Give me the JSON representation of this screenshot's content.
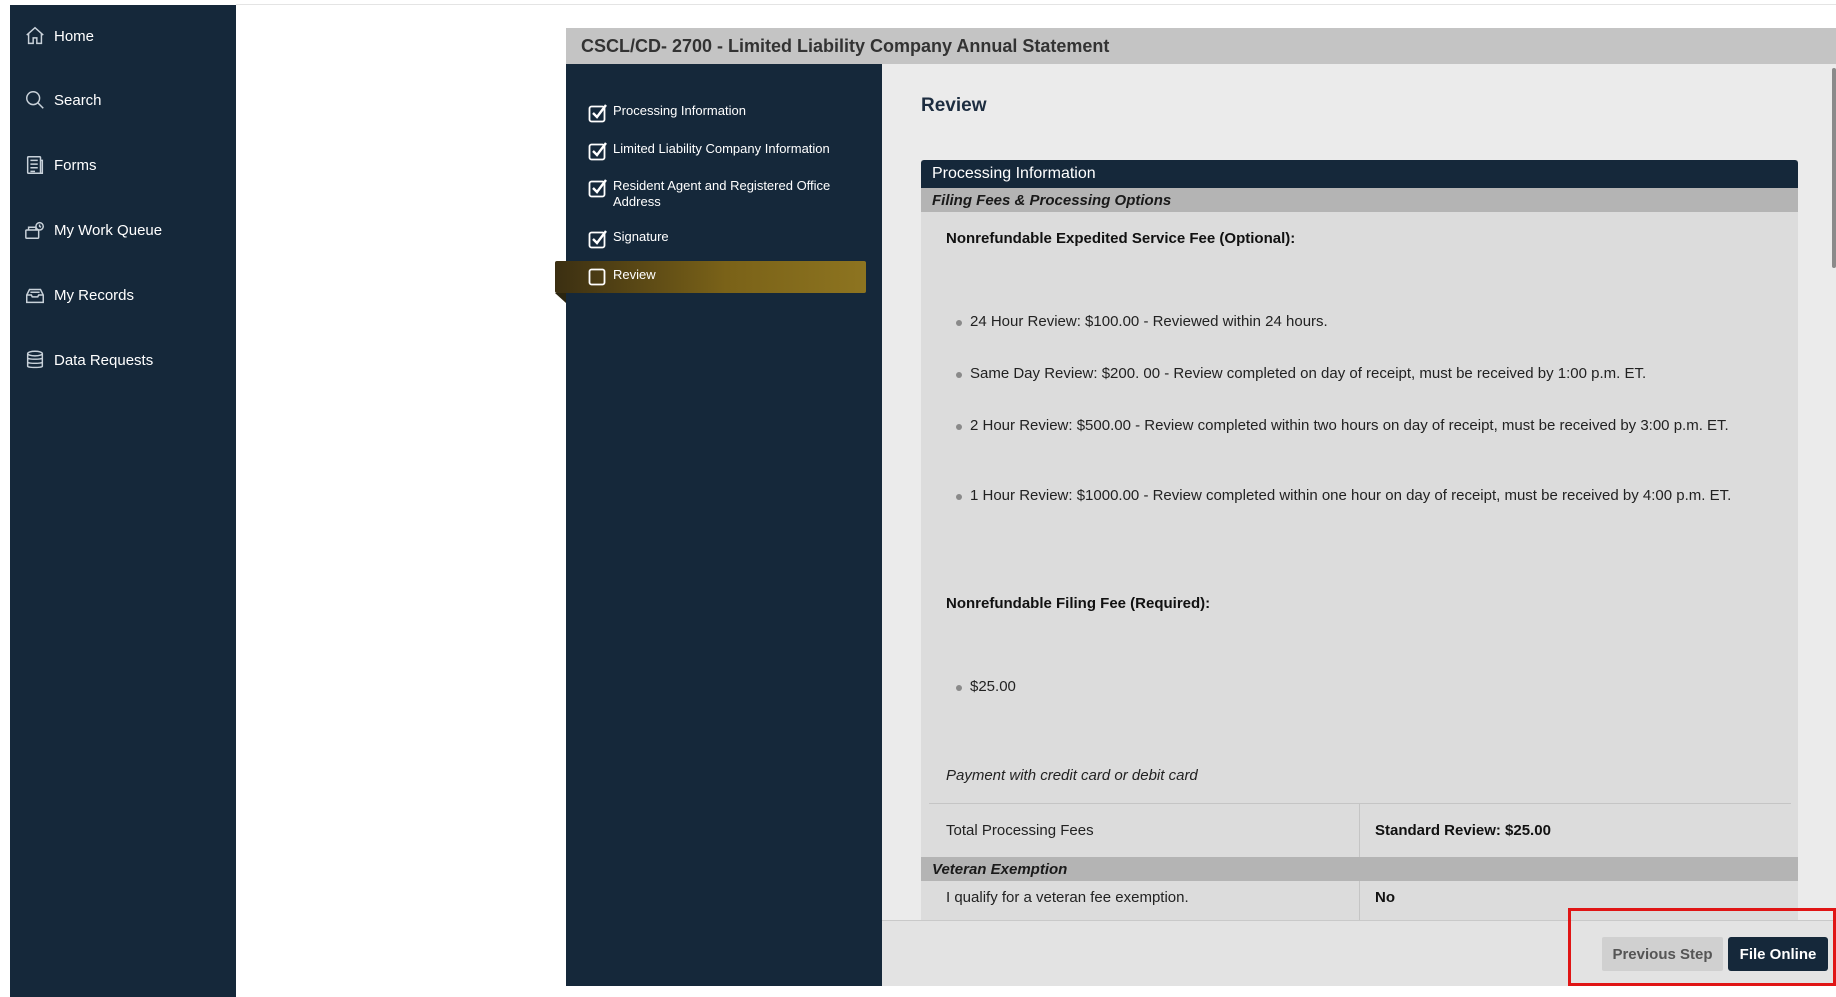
{
  "sidebar": {
    "items": [
      {
        "label": "Home",
        "icon": "home-icon"
      },
      {
        "label": "Search",
        "icon": "search-icon"
      },
      {
        "label": "Forms",
        "icon": "forms-icon"
      },
      {
        "label": "My Work Queue",
        "icon": "work-queue-icon"
      },
      {
        "label": "My Records",
        "icon": "records-icon"
      },
      {
        "label": "Data Requests",
        "icon": "database-icon"
      }
    ]
  },
  "form": {
    "title": "CSCL/CD- 2700 - Limited Liability Company Annual Statement",
    "steps": [
      {
        "label": "Processing Information",
        "checked": true
      },
      {
        "label": "Limited Liability Company Information",
        "checked": true
      },
      {
        "label": "Resident Agent and Registered Office Address",
        "checked": true
      },
      {
        "label": "Signature",
        "checked": true
      },
      {
        "label": "Review",
        "checked": false,
        "active": true
      }
    ]
  },
  "review": {
    "heading": "Review",
    "section_title": "Processing Information",
    "subsection_fees": "Filing Fees & Processing Options",
    "expedited_label": "Nonrefundable Expedited Service Fee (Optional):",
    "expedited_options": [
      "24 Hour Review: $100.00 - Reviewed within 24 hours.",
      "Same Day Review: $200. 00 - Review completed on day of receipt, must be received by 1:00 p.m. ET.",
      "2 Hour Review: $500.00 - Review completed within two hours on day of receipt, must be received by 3:00 p.m. ET.",
      "1 Hour Review: $1000.00 - Review completed within one hour on day of receipt, must be received by 4:00 p.m. ET."
    ],
    "filing_label": "Nonrefundable Filing Fee (Required):",
    "filing_options": [
      "$25.00"
    ],
    "payment_note": "Payment with credit card or debit card",
    "total_label": "Total Processing Fees",
    "total_value": "Standard Review: $25.00",
    "subsection_veteran": "Veteran Exemption",
    "veteran_label": "I qualify for a veteran fee exemption.",
    "veteran_value": "No"
  },
  "footer": {
    "previous_label": "Previous Step",
    "file_label": "File Online"
  },
  "colors": {
    "navy": "#15283a",
    "gold_active": "#8d7420",
    "highlight": "#e01515"
  }
}
